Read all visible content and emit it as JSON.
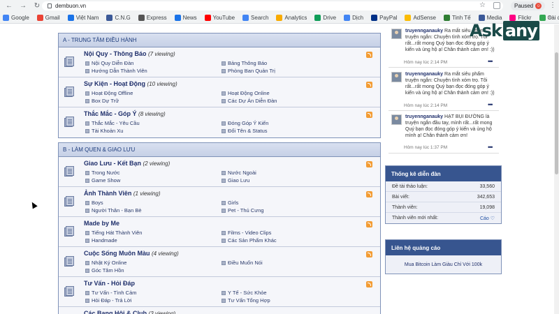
{
  "browser": {
    "url": "dembuon.vn",
    "paused_label": "Paused",
    "bookmarks": [
      {
        "label": "Google",
        "color": "#4285f4"
      },
      {
        "label": "Gmail",
        "color": "#ea4335"
      },
      {
        "label": "Việt Nam",
        "color": "#1a73e8"
      },
      {
        "label": "C.N.G",
        "color": "#3b5998"
      },
      {
        "label": "Express",
        "color": "#555555"
      },
      {
        "label": "News",
        "color": "#1a73e8"
      },
      {
        "label": "YouTube",
        "color": "#ff0000"
      },
      {
        "label": "Search",
        "color": "#4285f4"
      },
      {
        "label": "Analytics",
        "color": "#f9ab00"
      },
      {
        "label": "Drive",
        "color": "#0f9d58"
      },
      {
        "label": "Dịch",
        "color": "#4285f4"
      },
      {
        "label": "PayPal",
        "color": "#003087"
      },
      {
        "label": "AdSense",
        "color": "#fbbc04"
      },
      {
        "label": "Tinh Tế",
        "color": "#2e7d32"
      },
      {
        "label": "Media",
        "color": "#3b5998"
      },
      {
        "label": "Flickr",
        "color": "#ff0084"
      },
      {
        "label": "Cài đặt",
        "color": "#34a853"
      }
    ]
  },
  "categories": [
    {
      "title": "A - TRUNG TÂM ĐIỀU HÀNH",
      "forums": [
        {
          "title": "Nội Quy - Thông Báo",
          "viewing": "(7 viewing)",
          "subs": [
            "Nội Quy Diễn Đàn",
            "Hướng Dẫn Thành Viên",
            "Bảng Thông Báo",
            "Phòng Ban Quản Trị"
          ]
        },
        {
          "title": "Sự Kiện - Hoạt Động",
          "viewing": "(10 viewing)",
          "subs": [
            "Hoạt Động Offline",
            "Box Dự Trữ",
            "Hoạt Động Online",
            "Các Dự Án Diễn Đàn"
          ]
        },
        {
          "title": "Thắc Mắc - Góp Ý",
          "viewing": "(8 viewing)",
          "subs": [
            "Thắc Mắc - Yêu Cầu",
            "Tài Khoản Xu",
            "Đóng Góp Ý Kiến",
            "Đổi Tên & Status"
          ]
        }
      ]
    },
    {
      "title": "B - LÀM QUEN & GIAO LƯU",
      "forums": [
        {
          "title": "Giao Lưu - Kết Bạn",
          "viewing": "(2 viewing)",
          "subs": [
            "Trong Nước",
            "Game Show",
            "Nước Ngoài",
            "Giao Lưu"
          ]
        },
        {
          "title": "Ảnh Thành Viên",
          "viewing": "(1 viewing)",
          "subs": [
            "Boys",
            "Người Thân - Bạn Bè",
            "Girls",
            "Pet - Thú Cưng"
          ]
        },
        {
          "title": "Made by Me",
          "viewing": "",
          "subs": [
            "Tiếng Hát Thành Viên",
            "Handmade",
            "Films - Video Clips",
            "Các Sản Phẩm Khác"
          ]
        },
        {
          "title": "Cuộc Sống Muôn Màu",
          "viewing": "(4 viewing)",
          "subs": [
            "Nhật Ký Online",
            "Góc Tâm Hồn",
            "Điều Muốn Nói"
          ]
        },
        {
          "title": "Tư Vấn - Hỏi Đáp",
          "viewing": "",
          "subs": [
            "Tư Vấn - Tình Cảm",
            "Hỏi Đáp - Trả Lời",
            "Y Tế - Sức Khỏe",
            "Tư Vấn Tổng Hợp"
          ]
        },
        {
          "title": "Các Bang Hội & Club",
          "viewing": "(3 viewing)",
          "subs": []
        }
      ]
    }
  ],
  "chat": [
    {
      "user": "truyennganauky",
      "text": "Ra mắt siêu phẩm truyện ngắn: Chuyện tình xóm trọ. Tôi rất...rất mong Quý bạn đọc đóng góp ý kiến và ủng hộ ạ! Chân thành cảm ơn! :))",
      "time": "Hôm nay lúc 2:14 PM"
    },
    {
      "user": "truyennganauky",
      "text": "Ra mắt siêu phẩm truyện ngắn: Chuyện tình xóm trọ. Tôi rất...rất mong Quý bạn đọc đóng góp ý kiến và ủng hộ ạ! Chân thành cảm ơn! :))",
      "time": "Hôm nay lúc 2:14 PM"
    },
    {
      "user": "truyennganauky",
      "text": "HẠT BỤI ĐƯỜNG là truyện ngắn đầu tay, mình rất...rất mong Quý bạn đọc đóng góp ý kiến và ủng hộ mình ạ! Chân thành cảm ơn!",
      "time": "Hôm nay lúc 1:37 PM"
    }
  ],
  "stats": {
    "title": "Thống kê diễn đàn",
    "rows": [
      {
        "label": "Đề tài thảo luận:",
        "value": "33,560"
      },
      {
        "label": "Bài viết:",
        "value": "342,653"
      },
      {
        "label": "Thành viên:",
        "value": "19,098"
      },
      {
        "label": "Thành viên mới nhất:",
        "value": "Cáo ♡"
      }
    ]
  },
  "ads": {
    "title": "Liên hệ quảng cáo",
    "link": "Mua Bitcoin Làm Giàu Chỉ Với 100k"
  },
  "watermark": {
    "ask": "Ask",
    "any": "any"
  }
}
